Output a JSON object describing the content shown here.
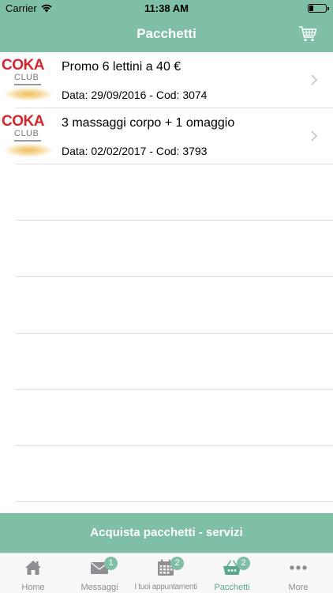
{
  "status": {
    "carrier": "Carrier",
    "time": "11:38 AM"
  },
  "nav": {
    "title": "Pacchetti",
    "cart_icon": "cart-icon"
  },
  "brand": {
    "logo_top": "COKA",
    "logo_bottom": "CLUB",
    "accent": "#7fbfa6",
    "logo_red": "#d6262c"
  },
  "packages": [
    {
      "title": "Promo 6 lettini a 40 €",
      "details": "Data: 29/09/2016 - Cod: 3074"
    },
    {
      "title": "3 massaggi corpo + 1 omaggio",
      "details": "Data: 02/02/2017 - Cod: 3793"
    }
  ],
  "buy_button": "Acquista pacchetti - servizi",
  "tabs": [
    {
      "label": "Home",
      "icon": "home-icon",
      "badge": ""
    },
    {
      "label": "Messaggi",
      "icon": "envelope-icon",
      "badge": "1"
    },
    {
      "label": "I tuoi appuntamenti",
      "icon": "calendar-icon",
      "badge": "2"
    },
    {
      "label": "Pacchetti",
      "icon": "basket-icon",
      "badge": "2",
      "active": true
    },
    {
      "label": "More",
      "icon": "more-icon",
      "badge": ""
    }
  ]
}
